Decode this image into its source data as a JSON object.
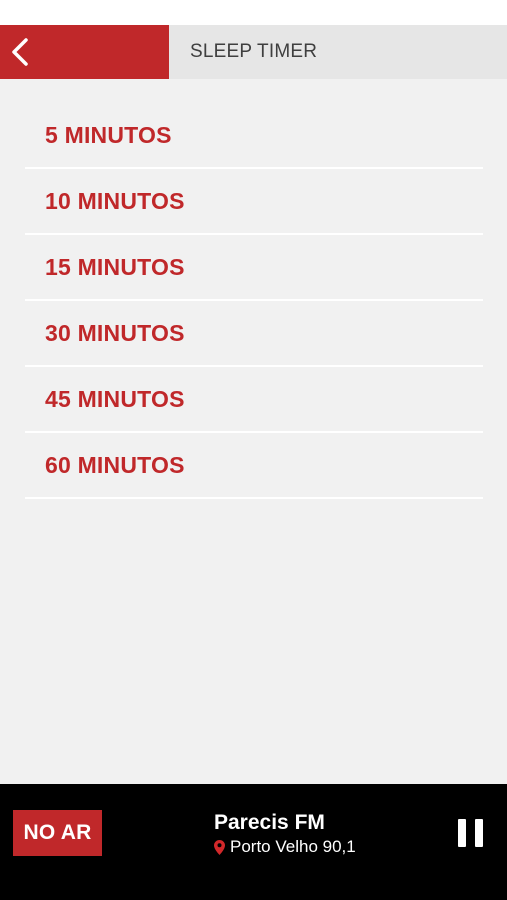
{
  "header": {
    "title": "SLEEP TIMER",
    "back_icon": "chevron-left-icon"
  },
  "timer_options": [
    {
      "label": "5 MINUTOS"
    },
    {
      "label": "10 MINUTOS"
    },
    {
      "label": "15 MINUTOS"
    },
    {
      "label": "30 MINUTOS"
    },
    {
      "label": "45 MINUTOS"
    },
    {
      "label": "60 MINUTOS"
    }
  ],
  "player": {
    "live_label": "NO AR",
    "station_name": "Parecis FM",
    "location": "Porto Velho 90,1",
    "location_icon": "map-pin-icon",
    "control_icon": "pause-icon"
  },
  "colors": {
    "accent": "#c0282a",
    "header_bg": "#e6e6e6",
    "page_bg": "#f1f1f1",
    "player_bg": "#000000"
  }
}
